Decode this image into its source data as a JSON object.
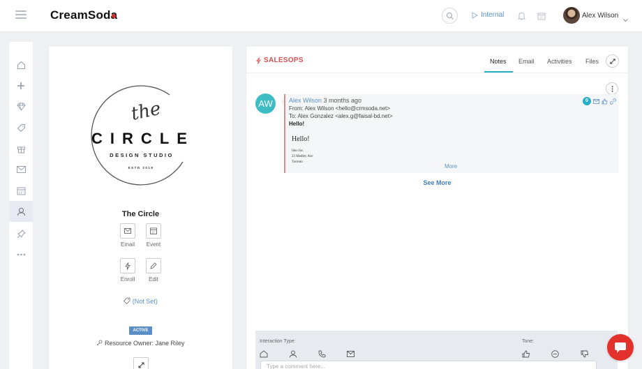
{
  "header": {
    "brand": "CreamSoda",
    "status_label": "Internal",
    "user_name": "Alex Wilson"
  },
  "nav": {
    "items": [
      "home-icon",
      "plus-icon",
      "diamond-icon",
      "tag-icon",
      "gift-icon",
      "mail-icon",
      "calendar-icon",
      "user-icon",
      "pin-icon",
      "more-icon"
    ],
    "active_index": 7
  },
  "profile": {
    "logo": {
      "top_script": "the",
      "word": "CIRCLE",
      "subtitle": "DESIGN STUDIO",
      "established": "ESTD 2019"
    },
    "name": "The Circle",
    "actions": [
      {
        "label": "Email",
        "icon": "mail-icon"
      },
      {
        "label": "Event",
        "icon": "calendar-icon"
      },
      {
        "label": "Enroll",
        "icon": "lightning-icon"
      },
      {
        "label": "Edit",
        "icon": "pen-icon"
      }
    ],
    "tags_value": "(Not Set)",
    "status_badge": "ACTIVE",
    "owner": "Resource Owner: Jane Riley"
  },
  "panel": {
    "title": "SALESOPS",
    "tabs": [
      {
        "label": "Notes",
        "active": true
      },
      {
        "label": "Email",
        "active": false
      },
      {
        "label": "Activities",
        "active": false
      },
      {
        "label": "Files",
        "active": false
      }
    ],
    "note": {
      "avatar_initials": "AW",
      "author": "Alex Wilson",
      "time": "3 months ago",
      "from": "From: Alex Wilson <hello@crmsoda.net>",
      "to": "To: Alex Gonzalez <alex.g@faisal-bd.net>",
      "subject": "Hello!",
      "body_greeting": "Hello!",
      "body_lines": [
        "Inks Inc.",
        "23 Medley Ave",
        "Toronto"
      ],
      "more_label": "More",
      "count": "0"
    },
    "see_more": "See More",
    "compose": {
      "interaction_label": "Interaction Type:",
      "tone_label": "Tone:",
      "comment_placeholder": "Type a comment here..."
    }
  },
  "colors": {
    "accent": "#27b0c4",
    "brand_red": "#d0302f",
    "link_blue": "#5a8fc8",
    "chat_red": "#e3312b"
  }
}
